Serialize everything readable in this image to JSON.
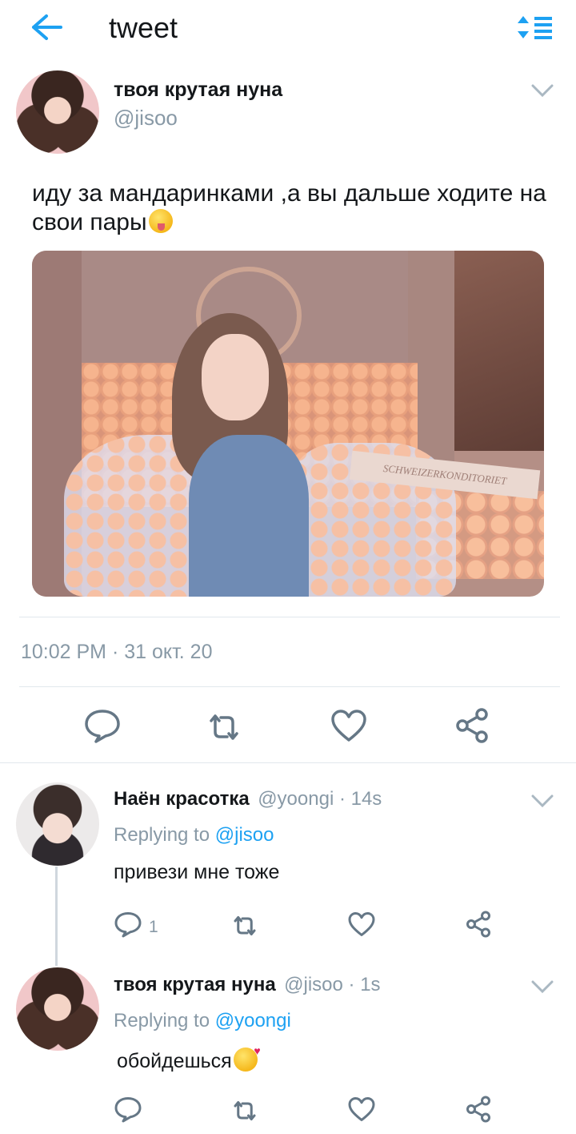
{
  "header": {
    "title": "tweet",
    "back_icon": "arrow-left-icon",
    "sort_icon": "sort-list-icon",
    "accent": "#1da1f2"
  },
  "tweet": {
    "author_name": "твоя крутая нуна",
    "author_handle": "@jisoo",
    "text": "иду за мандаринками ,а вы дальше ходите на свои пары",
    "text_emoji": "zany-face-emoji",
    "photo_sign_text": "SCHWEIZERKONDITORIET",
    "timestamp": "10:02 PM · 31 окт. 20",
    "actions": [
      "reply-icon",
      "retweet-icon",
      "like-icon",
      "share-icon"
    ]
  },
  "replies": [
    {
      "author_name": "Наён красотка",
      "author_handle": "@yoongi",
      "time": " · 14s",
      "replying_prefix": "Replying to ",
      "replying_to": "@jisoo",
      "text": "привези мне тоже",
      "reply_count": "1"
    },
    {
      "author_name": "твоя крутая нуна",
      "author_handle": "@jisoo",
      "time": " · 1s",
      "replying_prefix": "Replying to ",
      "replying_to": "@yoongi",
      "text": "обойдешься",
      "text_emoji": "kissing-heart-emoji"
    }
  ],
  "colors": {
    "link": "#1da1f2",
    "muted": "#8899a6",
    "divider": "#e1e8ed"
  }
}
